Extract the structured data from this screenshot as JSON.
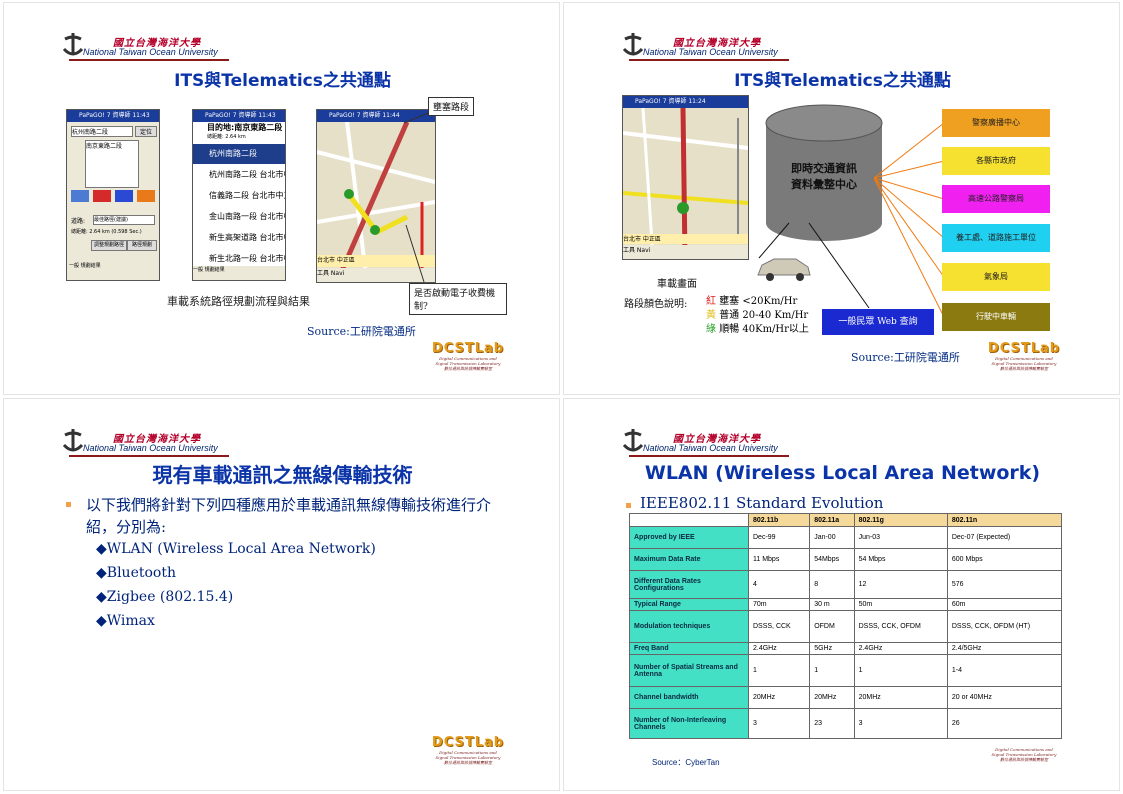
{
  "logo": {
    "name_cn": "國立台灣海洋大學",
    "name_en": "National Taiwan Ocean University"
  },
  "lab": {
    "name": "DCSTLab",
    "tagline1": "Digital Communications and",
    "tagline2": "Signal Transmission Laboratory",
    "tagline3": "數位通訊與訊號傳輸實驗室"
  },
  "slide1": {
    "title": "ITS與Telematics之共通點",
    "screen1": {
      "bar": "PaPaGO! 7 資導師  11:43",
      "field": "杭州南路二段",
      "btn": "定位",
      "item": "南京東路二段",
      "icons": [
        "交通查詢",
        "我的地標",
        "我的家",
        "路徑記錄"
      ],
      "mode_label": "道路:",
      "mode_value": "最佳路徑(建議)",
      "dist": "總距離: 2.64 km  (0.598 Sec.)",
      "btn1": "調整規劃路徑",
      "btn2": "路徑規劃",
      "tabs": "一般  規劃結果"
    },
    "screen2": {
      "bar": "PaPaGO! 7 資導師  11:43",
      "dest": "目的地:南京東路二段",
      "dist": "總距離: 2.64 km",
      "rows": [
        "杭州南路二段",
        "杭州南路二段 台北市中",
        "信義路二段 台北市中正",
        "金山南路一段 台北市中",
        "新生高架道路 台北市中",
        "新生北路一段 台北市中"
      ],
      "subs": [
        "",
        "134m",
        "331m",
        "840m",
        "729m",
        ""
      ],
      "tabs": "一般  規劃結果"
    },
    "screen3": {
      "bar": "PaPaGO! 7 資導師  11:44",
      "street": "台北市 中正區",
      "toolbar": "工具  Navi"
    },
    "callout_top": "壅塞路段",
    "callout_bottom": "是否啟動電子收費機制?",
    "caption": "車載系統路徑規劃流程與結果",
    "source": "Source:工研院電通所"
  },
  "slide2": {
    "title": "ITS與Telematics之共通點",
    "map_bar": "PaPaGO! 7 資導師  11:24",
    "map_street": "台北市 中正區",
    "center": "即時交通資訊資料彙整中心",
    "center1": "即時交通資訊",
    "center2": "資料彙整中心",
    "boxes": [
      "警察廣播中心",
      "各縣市政府",
      "高速公路警察局",
      "養工處、道路施工單位",
      "氣象局",
      "行駛中車輛"
    ],
    "car_caption": "車載畫面",
    "legend_label": "路段顏色說明:",
    "legend": [
      {
        "c": "紅",
        "state": "壅塞",
        "speed": "<20Km/Hr"
      },
      {
        "c": "黃",
        "state": "普通",
        "speed": "20-40 Km/Hr"
      },
      {
        "c": "綠",
        "state": "順暢",
        "speed": "40Km/Hr以上"
      }
    ],
    "web_box": "一般民眾 Web 查詢",
    "source": "Source:工研院電通所"
  },
  "slide3": {
    "title": "現有車載通訊之無線傳輸技術",
    "intro": "以下我們將針對下列四種應用於車載通訊無線傳輸技術進行介紹，分別為:",
    "items": [
      "WLAN (Wireless Local Area Network)",
      "Bluetooth",
      "Zigbee (802.15.4)",
      "Wimax"
    ]
  },
  "slide4": {
    "title": "WLAN (Wireless Local Area Network)",
    "bullet": "IEEE802.11 Standard Evolution",
    "table": {
      "headers": [
        "",
        "802.11b",
        "802.11a",
        "802.11g",
        "802.11n"
      ],
      "rows": [
        [
          "Approved by IEEE",
          "Dec-99",
          "Jan-00",
          "Jun-03",
          "Dec-07 (Expected)"
        ],
        [
          "Maximum Data Rate",
          "11 Mbps",
          "54Mbps",
          "54 Mbps",
          "600 Mbps"
        ],
        [
          "Different Data Rates Configurations",
          "4",
          "8",
          "12",
          "576"
        ],
        [
          "Typical Range",
          "70m",
          "30 m",
          "50m",
          "60m"
        ],
        [
          "Modulation techniques",
          "DSSS, CCK",
          "OFDM",
          "DSSS, CCK, OFDM",
          "DSSS, CCK, OFDM (HT)"
        ],
        [
          "Freq Band",
          "2.4GHz",
          "5GHz",
          "2.4GHz",
          "2.4/5GHz"
        ],
        [
          "Number of Spatial Streams and Antenna",
          "1",
          "1",
          "1",
          "1-4"
        ],
        [
          "Channel bandwidth",
          "20MHz",
          "20MHz",
          "20MHz",
          "20 or 40MHz"
        ],
        [
          "Number of Non-Interleaving Channels",
          "3",
          "23",
          "3",
          "26"
        ]
      ]
    },
    "source": "Source：CyberTan"
  }
}
